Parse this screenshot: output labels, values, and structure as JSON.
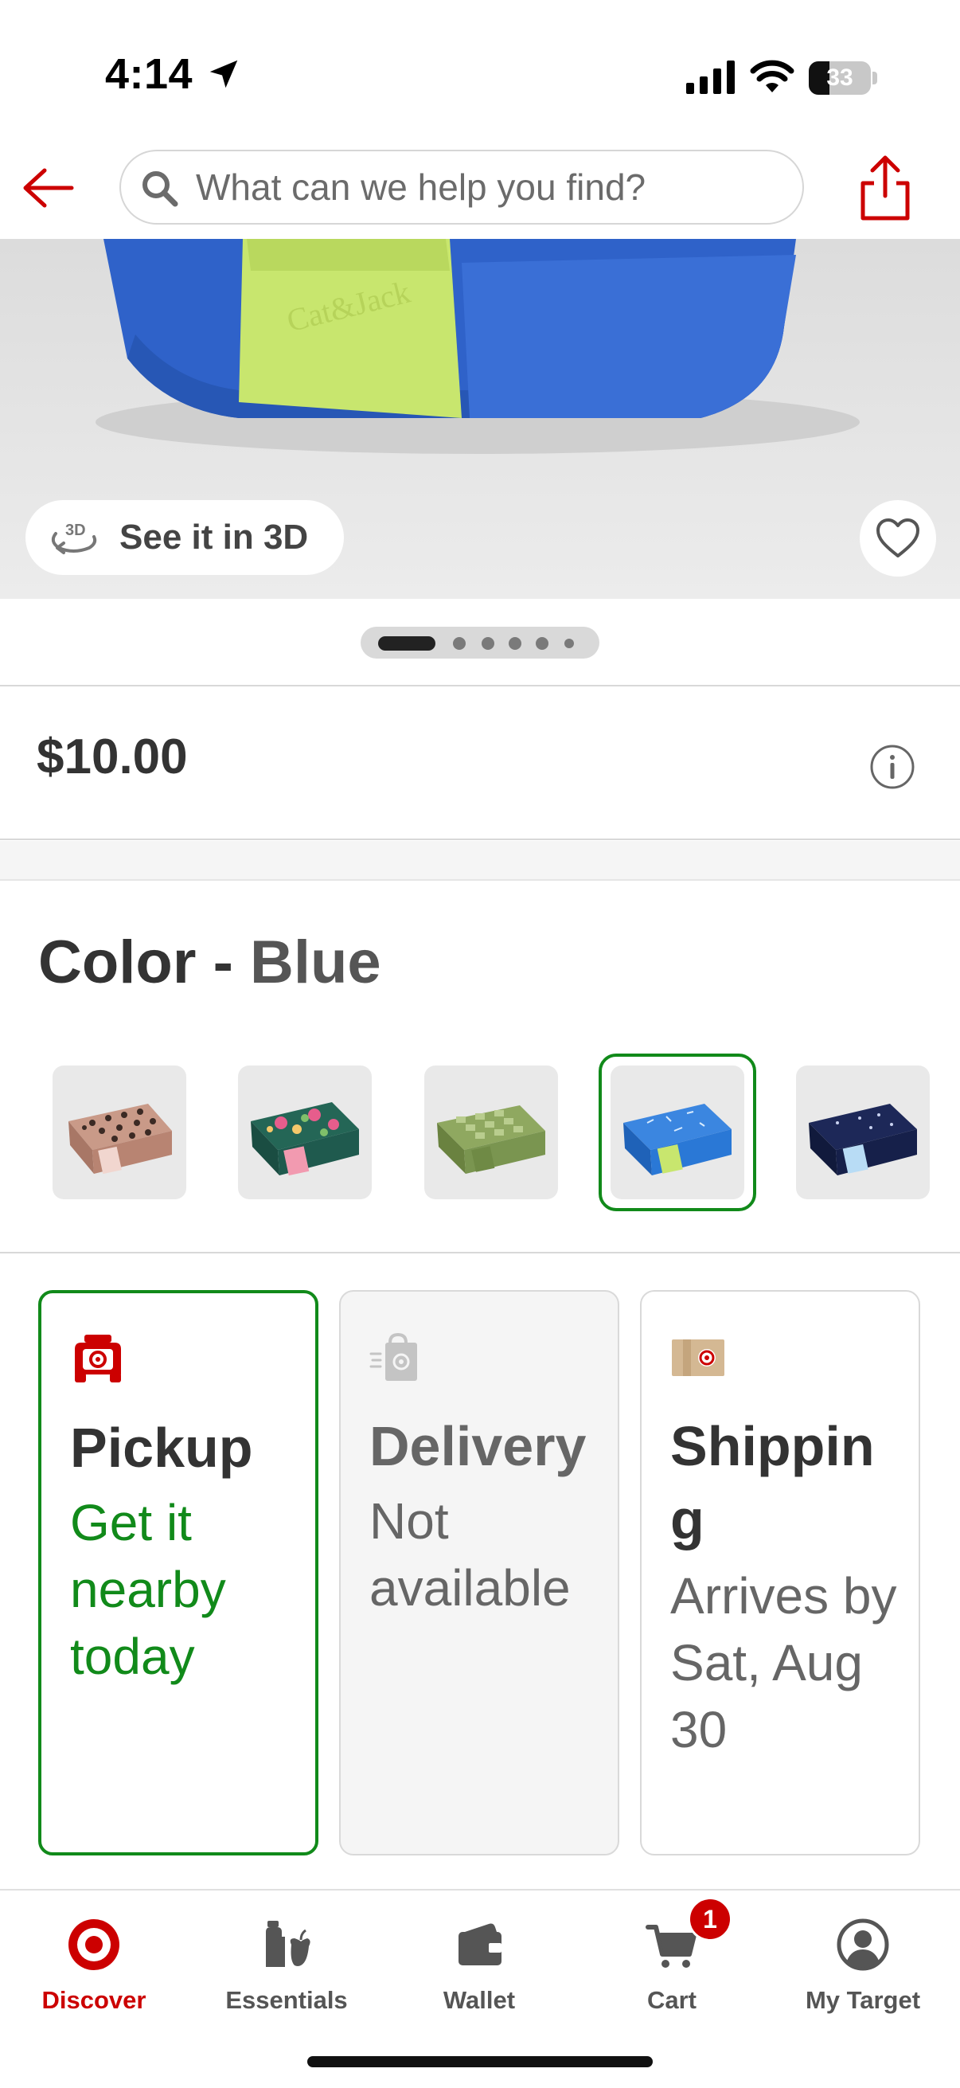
{
  "status_bar": {
    "time": "4:14",
    "battery_level": "33",
    "battery_fraction": 0.33,
    "icons": [
      "location-arrow-icon",
      "cellular-signal-icon",
      "wifi-icon",
      "battery-icon"
    ]
  },
  "header": {
    "search_placeholder": "What can we help you find?",
    "icons": [
      "back-arrow-icon",
      "search-icon",
      "share-icon"
    ],
    "accent_color": "#cc0000"
  },
  "product_image": {
    "see_3d_label": "See it in 3D",
    "icons": [
      "3d-rotate-icon",
      "heart-icon"
    ],
    "image_count": 6,
    "active_image_index": 0
  },
  "price": {
    "value": "$10.00",
    "icon": "info-icon"
  },
  "color": {
    "label": "Color",
    "separator": "-",
    "selected": "Blue",
    "swatches": [
      {
        "name": "leopard-pink",
        "color": "#b88a78"
      },
      {
        "name": "floral-green",
        "color": "#1f5a4e"
      },
      {
        "name": "checker-green",
        "color": "#7a9550"
      },
      {
        "name": "blue",
        "color": "#2a78d6",
        "selected": true
      },
      {
        "name": "navy",
        "color": "#16204a"
      }
    ],
    "selected_color": "#118a1a"
  },
  "fulfillment": {
    "options": [
      {
        "title": "Pickup",
        "subtitle": "Get it nearby today",
        "state": "selected",
        "icon": "pickup-car-icon"
      },
      {
        "title": "Delivery",
        "subtitle": "Not available",
        "state": "disabled",
        "icon": "delivery-bag-icon"
      },
      {
        "title": "Shipping",
        "subtitle": "Arrives by Sat, Aug 30",
        "state": "available",
        "icon": "shipping-box-icon"
      }
    ]
  },
  "bottom_nav": {
    "items": [
      {
        "label": "Discover",
        "icon": "target-bullseye-icon",
        "active": true
      },
      {
        "label": "Essentials",
        "icon": "essentials-icon"
      },
      {
        "label": "Wallet",
        "icon": "wallet-icon"
      },
      {
        "label": "Cart",
        "icon": "cart-icon"
      },
      {
        "label": "My Target",
        "icon": "account-icon"
      }
    ],
    "cart_count": "1"
  }
}
